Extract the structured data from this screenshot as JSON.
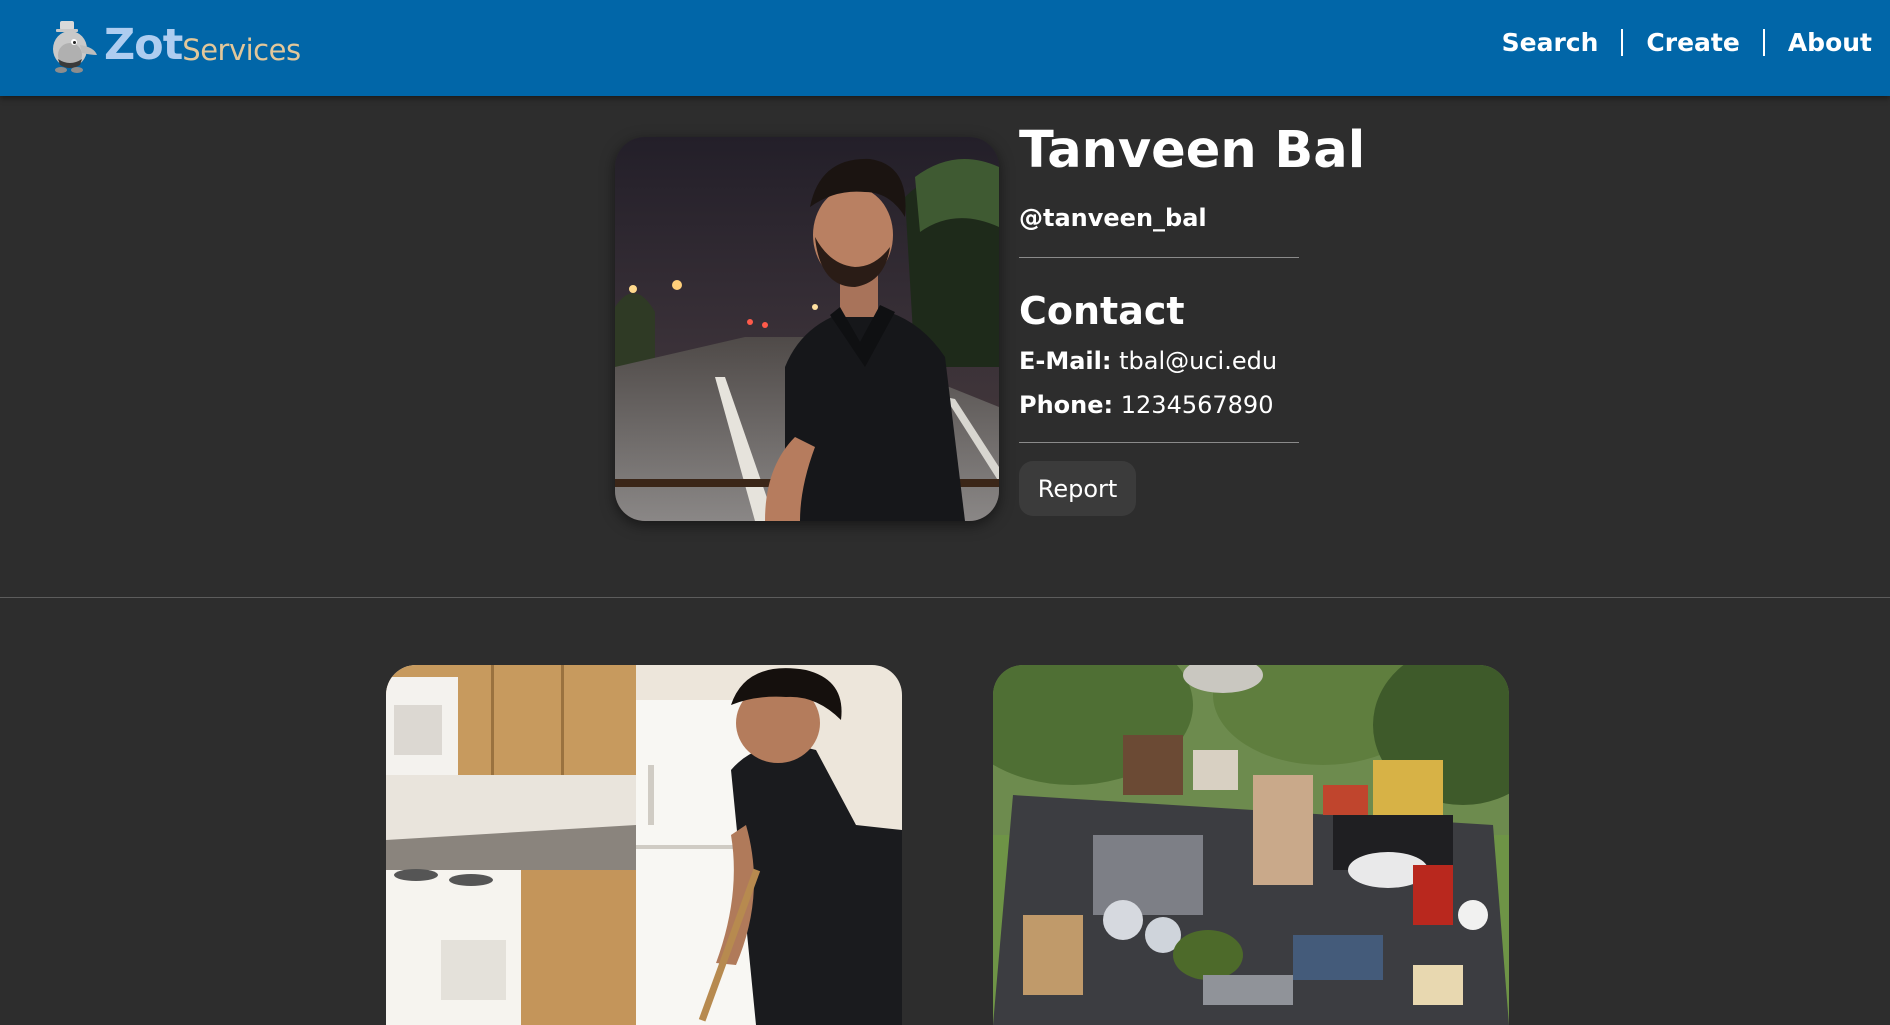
{
  "app": {
    "brand_primary": "Zot",
    "brand_secondary": "Services",
    "header_color": "#0166a8",
    "background_color": "#2d2d2d"
  },
  "nav": {
    "items": [
      {
        "label": "Search"
      },
      {
        "label": "Create"
      },
      {
        "label": "About"
      }
    ]
  },
  "profile": {
    "name": "Tanveen Bal",
    "username": "@tanveen_bal",
    "contact_heading": "Contact",
    "email_label": "E-Mail:",
    "email_value": "tbal@uci.edu",
    "phone_label": "Phone:",
    "phone_value": "1234567890",
    "report_label": "Report"
  },
  "icons": {
    "brand_logo": "anteater-mascot-icon"
  }
}
